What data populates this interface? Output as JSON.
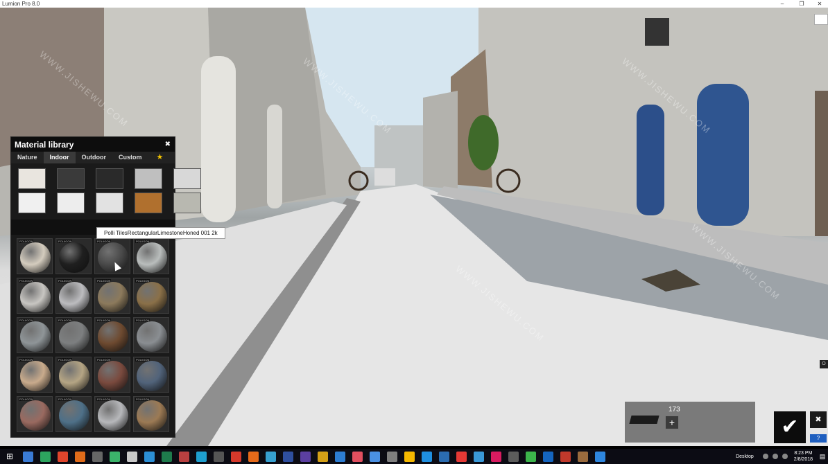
{
  "window": {
    "title": "Lumion Pro 8.0",
    "minimize": "–",
    "restore": "❐",
    "close": "✕"
  },
  "material_library": {
    "title": "Material library",
    "close": "✖",
    "tabs": [
      {
        "label": "Nature",
        "active": false
      },
      {
        "label": "Indoor",
        "active": true
      },
      {
        "label": "Outdoor",
        "active": false
      },
      {
        "label": "Custom",
        "active": false
      }
    ],
    "favorites_icon": "★",
    "category_swatches": [
      {
        "name": "plaster",
        "color": "#e9e5df"
      },
      {
        "name": "dark-glossy",
        "color": "#3a3a3a"
      },
      {
        "name": "leather",
        "color": "#2a2a2a"
      },
      {
        "name": "chrome",
        "color": "#bfbfbf"
      },
      {
        "name": "white-matte",
        "color": "#d8d8d8"
      },
      {
        "name": "white-glossy",
        "color": "#f0f0f0"
      },
      {
        "name": "marble",
        "color": "#ededed"
      },
      {
        "name": "tiles",
        "color": "#e2e2e2"
      },
      {
        "name": "wood",
        "color": "#b0702e"
      },
      {
        "name": "brushed-metal",
        "color": "#b8b8b0"
      }
    ],
    "tooltip": "Polli TilesRectangularLimestoneHoned 001 2k",
    "tag_label": "POLIIGON",
    "materials": [
      {
        "color": "#d4ccbe"
      },
      {
        "color": "#1f1f1f"
      },
      {
        "color": "#4a4a4a"
      },
      {
        "color": "#b9bdbc"
      },
      {
        "color": "#c8c6c2"
      },
      {
        "color": "#bcbcbf"
      },
      {
        "color": "#8c7a5c"
      },
      {
        "color": "#8a7048"
      },
      {
        "color": "#8f9598"
      },
      {
        "color": "#7d7f80"
      },
      {
        "color": "#6e4a30"
      },
      {
        "color": "#8a8e92"
      },
      {
        "color": "#c9ab8c"
      },
      {
        "color": "#b5a584"
      },
      {
        "color": "#7a4a3e"
      },
      {
        "color": "#51637a"
      },
      {
        "color": "#9a6a60"
      },
      {
        "color": "#4e7088"
      },
      {
        "color": "#b7b8bb"
      },
      {
        "color": "#9c7a54"
      }
    ]
  },
  "counter": {
    "value": "173",
    "add": "+"
  },
  "controls": {
    "ok": "✔",
    "close": "✖",
    "help": "?",
    "edge": "O"
  },
  "taskbar": {
    "start": "⊞",
    "desktop_label": "Desktop",
    "time": "8:23 PM",
    "date": "2/8/2018",
    "notifications": "▤",
    "icons": [
      "#3a7bd5",
      "#2da55f",
      "#e0452c",
      "#e06b1a",
      "#666",
      "#3bb36a",
      "#c8c8c8",
      "#2c8fd6",
      "#1e7b4c",
      "#b84040",
      "#1e9fcf",
      "#555",
      "#d6392b",
      "#e66a1a",
      "#37a0d0",
      "#2f4f9f",
      "#5b3fa0",
      "#d4a017",
      "#2d7dd2",
      "#e04f5f",
      "#4a90e2",
      "#7f7f7f",
      "#f5b800",
      "#1f8fe0",
      "#2b6cb0",
      "#e53935",
      "#3a99d8",
      "#d81b60",
      "#5c5c5c",
      "#3cb44b",
      "#1565c0",
      "#c0392b",
      "#9a6b3e",
      "#2e86de"
    ]
  },
  "watermark": "WWW.JISHEWU.COM"
}
